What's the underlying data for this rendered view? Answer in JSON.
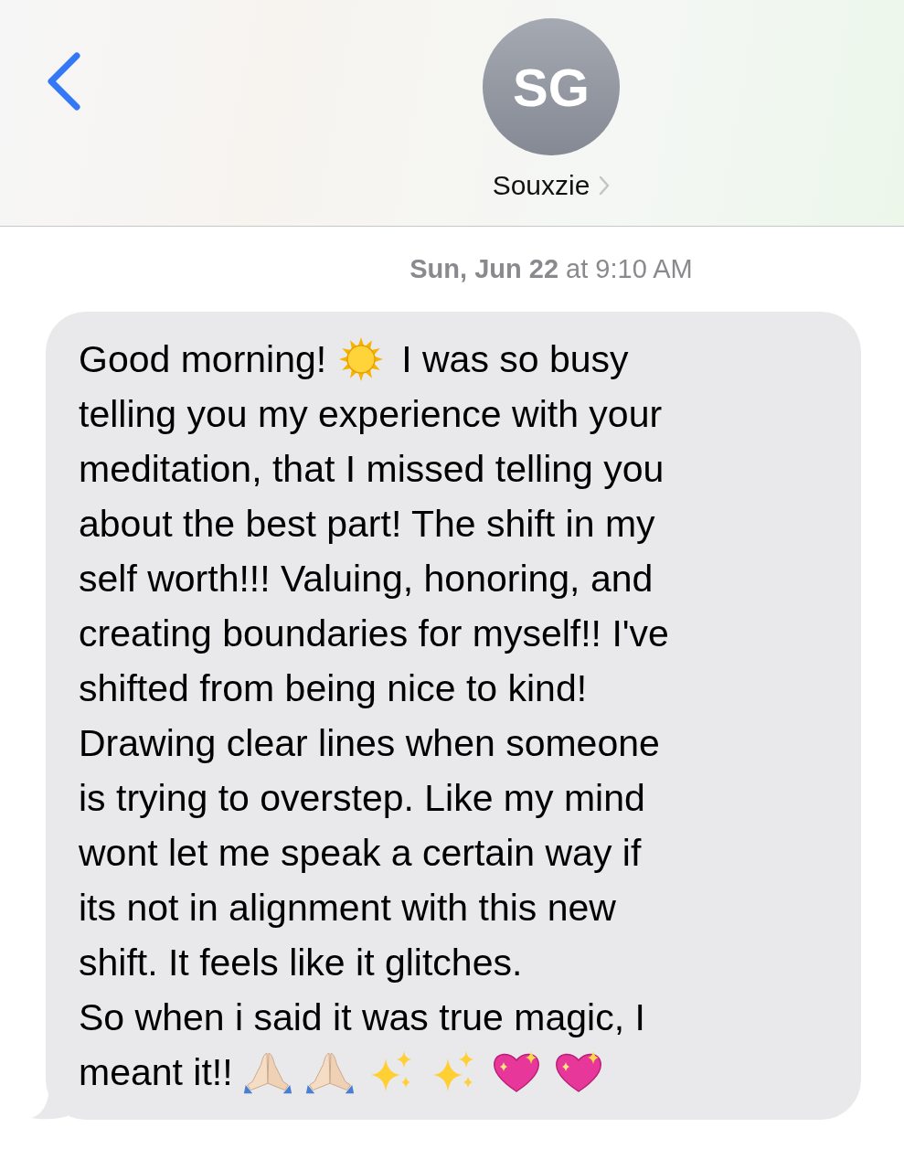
{
  "header": {
    "avatar_initials": "SG",
    "contact_name": "Souxzie"
  },
  "timestamp": "**Sun, Jun 22** at 9:10 AM",
  "message": {
    "lines": [
      [
        {
          "kind": "text",
          "text": "Good morning!"
        },
        {
          "kind": "sun"
        },
        {
          "kind": "text",
          "text": "I was so busy"
        }
      ],
      [
        {
          "kind": "text",
          "text": "telling you my experience with your"
        }
      ],
      [
        {
          "kind": "text",
          "text": "meditation, that I missed telling you"
        }
      ],
      [
        {
          "kind": "text",
          "text": "about the best part! The shift in my"
        }
      ],
      [
        {
          "kind": "text",
          "text": "self worth!!! Valuing, honoring, and"
        }
      ],
      [
        {
          "kind": "text",
          "text": "creating boundaries for myself!! I've"
        }
      ],
      [
        {
          "kind": "text",
          "text": "shifted from being nice to kind!"
        }
      ],
      [
        {
          "kind": "text",
          "text": "Drawing clear lines when someone"
        }
      ],
      [
        {
          "kind": "text",
          "text": "is trying to overstep. Like my mind"
        }
      ],
      [
        {
          "kind": "text",
          "text": "wont let me speak a certain way if"
        }
      ],
      [
        {
          "kind": "text",
          "text": "its not in alignment with this new"
        }
      ],
      [
        {
          "kind": "text",
          "text": "shift. It feels like it glitches."
        }
      ],
      [
        {
          "kind": "text",
          "text": "So when i said it was true magic, I"
        }
      ],
      [
        {
          "kind": "text",
          "text": "meant it!!"
        },
        {
          "kind": "pray"
        },
        {
          "kind": "pray"
        },
        {
          "kind": "sparkles"
        },
        {
          "kind": "sparkles"
        },
        {
          "kind": "heart"
        },
        {
          "kind": "heart"
        }
      ]
    ]
  }
}
